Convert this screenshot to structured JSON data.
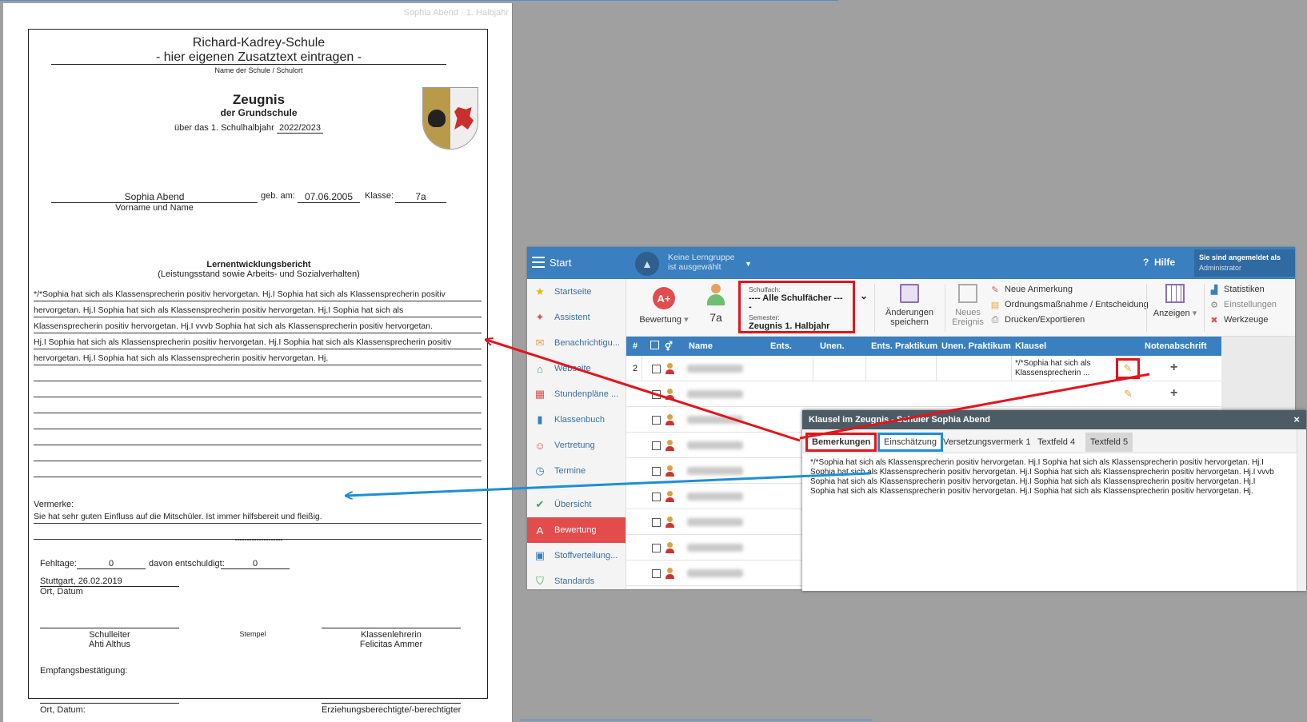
{
  "document": {
    "header_name": "Sophia Abend · 1. Halbjahr",
    "school_name": "Richard-Kadrey-Schule",
    "school_extra": "- hier eigenen Zusatztext eintragen -",
    "school_caption": "Name der Schule / Schulort",
    "title": "Zeugnis",
    "subtitle": "der Grundschule",
    "semester_prefix": "über das 1. Schulhalbjahr",
    "school_year": "2022/2023",
    "student_name": "Sophia Abend",
    "name_caption": "Vorname und Name",
    "birth_label": "geb. am:",
    "birth_date": "07.06.2005",
    "class_label": "Klasse:",
    "class_value": "7a",
    "report_title": "Lernentwicklungsbericht",
    "report_subtitle": "(Leistungsstand sowie Arbeits- und Sozialverhalten)",
    "report_lines": [
      "*/*Sophia hat sich als Klassensprecherin positiv hervorgetan. Hj.I Sophia hat sich als Klassensprecherin positiv",
      "hervorgetan. Hj.I Sophia hat sich als Klassensprecherin positiv hervorgetan. Hj.I Sophia hat sich als",
      "Klassensprecherin positiv hervorgetan. Hj.I   vvvb Sophia hat sich als Klassensprecherin positiv hervorgetan.",
      "Hj.I Sophia hat sich als Klassensprecherin positiv hervorgetan. Hj.I Sophia hat sich als Klassensprecherin positiv",
      "hervorgetan. Hj.I Sophia hat sich als Klassensprecherin positiv hervorgetan. Hj.",
      "",
      "",
      "",
      "",
      "",
      "",
      ""
    ],
    "remarks_label": "Vermerke:",
    "remarks_text": "Sie hat sehr guten Einfluss auf die Mitschüler. Ist immer hilfsbereit und fleißig.",
    "dashes": "--------------------",
    "absence_label": "Fehltage:",
    "absence_value": "0",
    "excused_label": "davon entschuldigt:",
    "excused_value": "0",
    "place_date": "Stuttgart, 26.02.2019",
    "place_date_caption": "Ort, Datum",
    "principal_label": "Schulleiter",
    "principal_name": "Ahti Althus",
    "stamp_label": "Stempel",
    "teacher_label": "Klassenlehrerin",
    "teacher_name": "Felicitas Ammer",
    "receipt_label": "Empfangsbestätigung:",
    "receipt_place_caption": "Ort, Datum:",
    "guardian_caption": "Erziehungsberechtigte/-berechtigter"
  },
  "app": {
    "start_label": "Start",
    "lerngruppe_line1": "Keine Lerngruppe",
    "lerngruppe_line2": "ist ausgewählt",
    "help_label": "Hilfe",
    "login_line1": "Sie sind angemeldet als",
    "login_line2": "Administrator",
    "sidebar": [
      {
        "label": "Startseite",
        "icon": "star-icon",
        "glyph": "★",
        "color": "#f0b400"
      },
      {
        "label": "Assistent",
        "icon": "wand-icon",
        "glyph": "✦",
        "color": "#d9534f"
      },
      {
        "label": "Benachrichtigu...",
        "icon": "envelope-icon",
        "glyph": "✉",
        "color": "#e8a33c"
      },
      {
        "label": "Webseite",
        "icon": "home-icon",
        "glyph": "⌂",
        "color": "#3aa55d"
      },
      {
        "label": "Stundenpläne ...",
        "icon": "calendar-icon",
        "glyph": "▦",
        "color": "#d9534f"
      },
      {
        "label": "Klassenbuch",
        "icon": "book-icon",
        "glyph": "▮",
        "color": "#3a7fbf"
      },
      {
        "label": "Vertretung",
        "icon": "person-icon",
        "glyph": "☺",
        "color": "#d9534f"
      },
      {
        "label": "Termine",
        "icon": "clock-icon",
        "glyph": "◷",
        "color": "#3a7fbf"
      },
      {
        "label": "Übersicht",
        "icon": "check-icon",
        "glyph": "✔",
        "color": "#3aa55d"
      },
      {
        "label": "Bewertung",
        "icon": "grade-icon",
        "glyph": "A",
        "color": "#ffffff"
      },
      {
        "label": "Stoffverteilung...",
        "icon": "briefcase-icon",
        "glyph": "▣",
        "color": "#3a7fbf"
      },
      {
        "label": "Standards",
        "icon": "shield-icon",
        "glyph": "⛉",
        "color": "#3aa55d"
      }
    ],
    "toolbar": {
      "bewertung_label": "Bewertung",
      "class_label": "7a",
      "schulfach_label": "Schulfach:",
      "schulfach_value": "---- Alle Schulfächer ----",
      "semester_label": "Semester:",
      "semester_value": "Zeugnis 1. Halbjahr",
      "save_label": "Änderungen speichern",
      "new_event_label": "Neues Ereignis",
      "new_note_label": "Neue Anmerkung",
      "measure_label": "Ordnungsmaßnahme / Entscheidung",
      "print_label": "Drucken/Exportieren",
      "show_label": "Anzeigen",
      "stats_label": "Statistiken",
      "settings_label": "Einstellungen",
      "tools_label": "Werkzeuge"
    },
    "grid": {
      "headers": [
        "#",
        "Name",
        "Ents.",
        "Unen.",
        "Ents. Praktikum",
        "Unen. Praktikum",
        "Klausel",
        "Notenabschrift"
      ],
      "first_row_num": "2",
      "first_row_klausel": "*/*Sophia hat sich als Klassensprecherin ...",
      "add_symbol": "+"
    },
    "dialog": {
      "title": "Klausel im Zeugnis - Schüler Sophia Abend",
      "close": "×",
      "tabs": [
        "Bemerkungen",
        "Einschätzung",
        "Versetzungsvermerk 1",
        "Textfeld 4",
        "Textfeld 5"
      ],
      "body": "*/*Sophia hat sich als Klassensprecherin positiv hervorgetan. Hj.I Sophia hat sich als Klassensprecherin positiv hervorgetan. Hj.I Sophia hat sich als Klassensprecherin positiv hervorgetan. Hj.I Sophia hat sich als Klassensprecherin positiv hervorgetan. Hj.I    vvvb Sophia hat sich als Klassensprecherin positiv hervorgetan. Hj.I Sophia hat sich als Klassensprecherin positiv hervorgetan. Hj.I Sophia hat sich als Klassensprecherin positiv hervorgetan. Hj.I Sophia  hat sich als Klassensprecherin positiv hervorgetan. Hj."
    }
  },
  "colors": {
    "accent_blue": "#3a7fbf",
    "highlight_red": "#e3141b",
    "highlight_blue": "#1d8fd6",
    "active_red": "#e24c4c"
  }
}
